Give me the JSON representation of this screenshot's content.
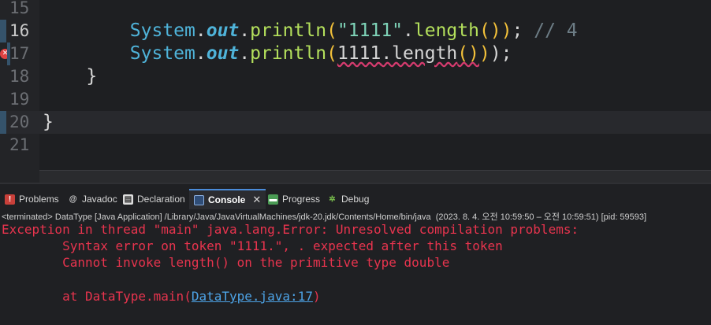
{
  "editor": {
    "lines": [
      {
        "num": "15",
        "code": ""
      },
      {
        "num": "16",
        "indent": "        ",
        "cls": "System",
        "field": "out",
        "method": "println",
        "arg": "\"1111\"",
        "call": "length",
        "end": ");",
        "comment": " // 4"
      },
      {
        "num": "17",
        "indent": "        ",
        "cls": "System",
        "field": "out",
        "method": "println",
        "arg": "1111",
        "dot_call": ".length",
        "end": ");"
      },
      {
        "num": "18",
        "code": "    }"
      },
      {
        "num": "19",
        "code": ""
      },
      {
        "num": "20",
        "code": "}"
      },
      {
        "num": "21",
        "code": ""
      }
    ]
  },
  "panel": {
    "tabs": [
      {
        "label": "Problems",
        "icon": "problems-icon"
      },
      {
        "label": "Javadoc",
        "icon": "javadoc-icon"
      },
      {
        "label": "Declaration",
        "icon": "declaration-icon"
      },
      {
        "label": "Console",
        "icon": "console-icon",
        "active": true,
        "close": "✕"
      },
      {
        "label": "Progress",
        "icon": "progress-icon"
      },
      {
        "label": "Debug",
        "icon": "debug-icon"
      }
    ],
    "status": "<terminated> DataType [Java Application] /Library/Java/JavaVirtualMachines/jdk-20.jdk/Contents/Home/bin/java  (2023. 8. 4. 오전 10:59:50 – 오전 10:59:51) [pid: 59593]",
    "console": {
      "line1": "Exception in thread \"main\" java.lang.Error: Unresolved compilation problems: ",
      "line2": "\tSyntax error on token \"1111.\", . expected after this token",
      "line3": "\tCannot invoke length() on the primitive type double",
      "line5_prefix": "\tat DataType.main(",
      "line5_link": "DataType.java:17",
      "line5_suffix": ")"
    }
  },
  "colors": {
    "error": "#e8344e",
    "link": "#4da3e6",
    "accent": "#4a8bd8"
  }
}
